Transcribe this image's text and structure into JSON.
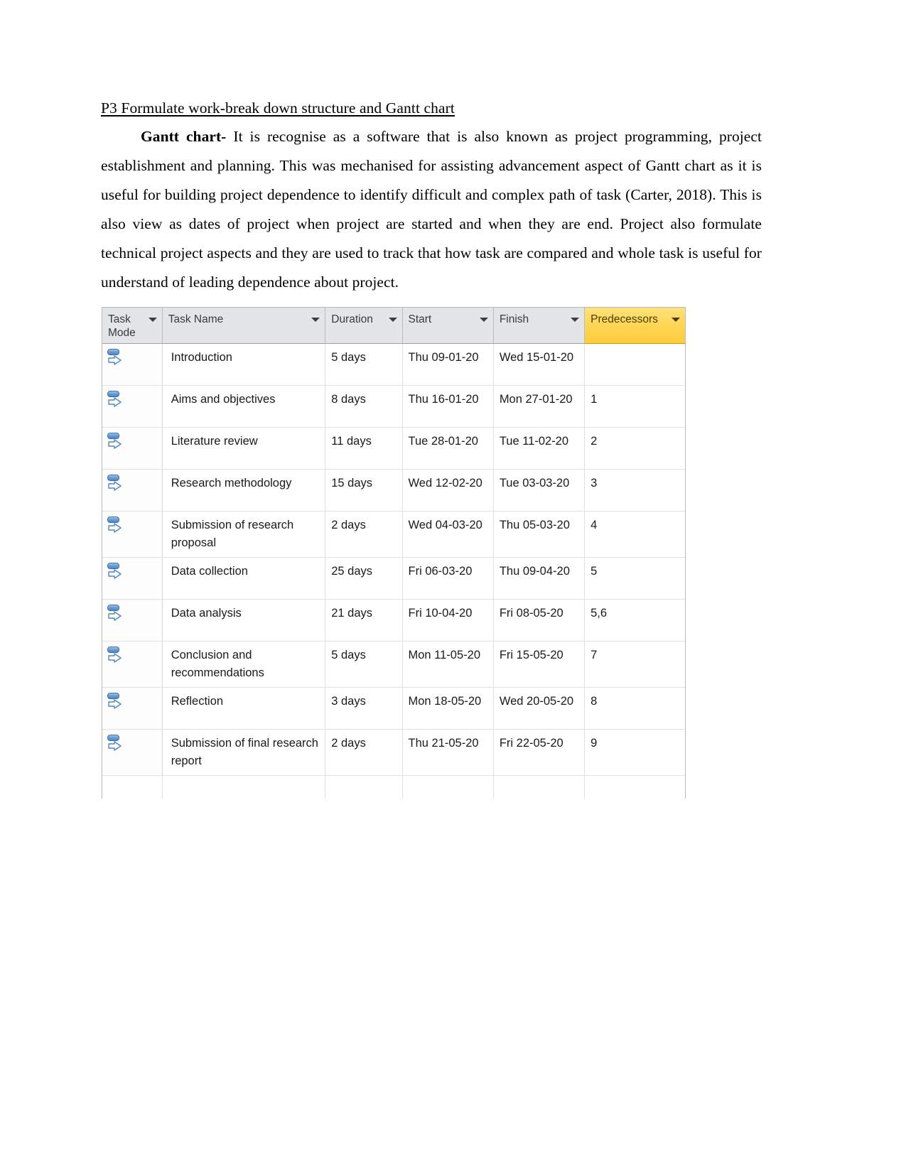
{
  "document": {
    "heading": "P3 Formulate work-break down structure and Gantt chart",
    "paragraph_lead": "Gantt chart-",
    "paragraph_body": " It is recognise as a software that is also known as project programming, project establishment and planning. This was mechanised for assisting advancement aspect of Gantt chart as it is useful for building project dependence to identify difficult and complex path of task (Carter, 2018). This is also view as dates of project when project are started and when they are end. Project also formulate technical project aspects and they are used to track that how task are compared and whole task is useful for understand of leading dependence about project."
  },
  "colors": {
    "header_background": "#e3e6e8",
    "predecessors_highlight": "#ffd451",
    "grid_line": "#dfe1e3",
    "task_mode_icon": "#4d86c4"
  },
  "gantt_table": {
    "columns": [
      {
        "key": "task_mode",
        "label": "Task Mode",
        "has_filter": true,
        "highlighted": false
      },
      {
        "key": "task_name",
        "label": "Task Name",
        "has_filter": true,
        "highlighted": false
      },
      {
        "key": "duration",
        "label": "Duration",
        "has_filter": true,
        "highlighted": false
      },
      {
        "key": "start",
        "label": "Start",
        "has_filter": true,
        "highlighted": false
      },
      {
        "key": "finish",
        "label": "Finish",
        "has_filter": true,
        "highlighted": false
      },
      {
        "key": "predecessors",
        "label": "Predecessors",
        "has_filter": true,
        "highlighted": true
      }
    ],
    "task_mode_icon": "auto-scheduled-icon",
    "rows": [
      {
        "task_mode": "auto-scheduled-icon",
        "task_name": "Introduction",
        "duration": "5 days",
        "start": "Thu 09-01-20",
        "finish": "Wed 15-01-20",
        "predecessors": ""
      },
      {
        "task_mode": "auto-scheduled-icon",
        "task_name": "Aims and objectives",
        "duration": "8 days",
        "start": "Thu 16-01-20",
        "finish": "Mon 27-01-20",
        "predecessors": "1"
      },
      {
        "task_mode": "auto-scheduled-icon",
        "task_name": "Literature review",
        "duration": "11 days",
        "start": "Tue 28-01-20",
        "finish": "Tue 11-02-20",
        "predecessors": "2"
      },
      {
        "task_mode": "auto-scheduled-icon",
        "task_name": "Research methodology",
        "duration": "15 days",
        "start": "Wed 12-02-20",
        "finish": "Tue 03-03-20",
        "predecessors": "3"
      },
      {
        "task_mode": "auto-scheduled-icon",
        "task_name": "Submission of research proposal",
        "duration": "2 days",
        "start": "Wed 04-03-20",
        "finish": "Thu 05-03-20",
        "predecessors": "4"
      },
      {
        "task_mode": "auto-scheduled-icon",
        "task_name": "Data collection",
        "duration": "25 days",
        "start": "Fri 06-03-20",
        "finish": "Thu 09-04-20",
        "predecessors": "5"
      },
      {
        "task_mode": "auto-scheduled-icon",
        "task_name": "Data analysis",
        "duration": "21 days",
        "start": "Fri 10-04-20",
        "finish": "Fri 08-05-20",
        "predecessors": "5,6"
      },
      {
        "task_mode": "auto-scheduled-icon",
        "task_name": "Conclusion and recommendations",
        "duration": "5 days",
        "start": "Mon 11-05-20",
        "finish": "Fri 15-05-20",
        "predecessors": "7"
      },
      {
        "task_mode": "auto-scheduled-icon",
        "task_name": "Reflection",
        "duration": "3 days",
        "start": "Mon 18-05-20",
        "finish": "Wed 20-05-20",
        "predecessors": "8"
      },
      {
        "task_mode": "auto-scheduled-icon",
        "task_name": "Submission of final research report",
        "duration": "2 days",
        "start": "Thu 21-05-20",
        "finish": "Fri 22-05-20",
        "predecessors": "9"
      }
    ]
  }
}
